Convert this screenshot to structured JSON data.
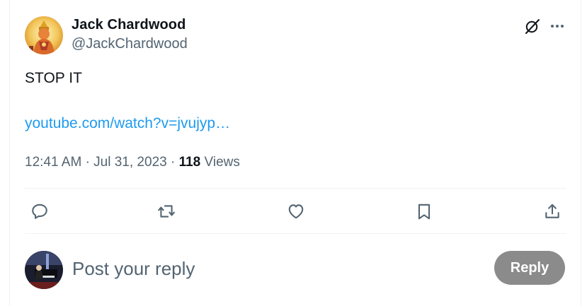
{
  "tweet": {
    "author": {
      "display_name": "Jack Chardwood",
      "handle": "@JackChardwood",
      "avatar_icon": "deity-avatar"
    },
    "text": "STOP IT",
    "link": "youtube.com/watch?v=jvujyp…",
    "meta": {
      "time": "12:41 AM",
      "separator": "·",
      "date": "Jul 31, 2023",
      "views_count": "118",
      "views_label": "Views"
    },
    "header_icons": [
      "grok-icon",
      "more-icon"
    ],
    "actions": [
      {
        "icon": "reply-icon"
      },
      {
        "icon": "retweet-icon"
      },
      {
        "icon": "like-icon"
      },
      {
        "icon": "bookmark-icon"
      },
      {
        "icon": "share-icon"
      }
    ]
  },
  "reply_box": {
    "placeholder": "Post your reply",
    "button_label": "Reply",
    "avatar_icon": "pianist-avatar"
  },
  "colors": {
    "link": "#1d9bf0",
    "secondary_text": "#536471",
    "primary_text": "#0f1419",
    "reply_button_bg": "#8b8b8b",
    "divider": "#eff3f4"
  }
}
